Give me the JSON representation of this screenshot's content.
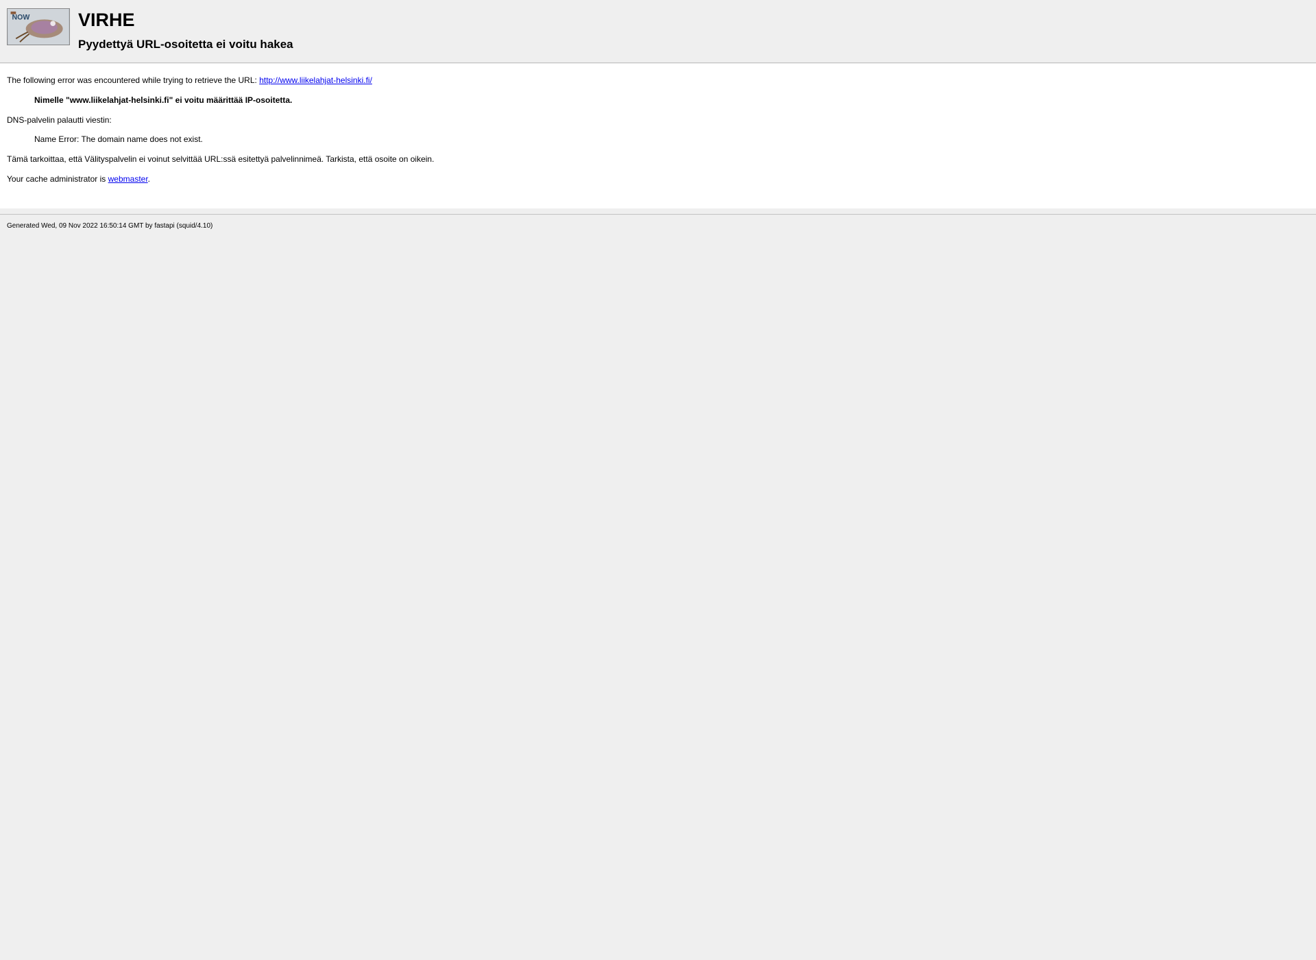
{
  "header": {
    "title": "VIRHE",
    "subtitle": "Pyydettyä URL-osoitetta ei voitu hakea"
  },
  "content": {
    "intro_text": "The following error was encountered while trying to retrieve the URL: ",
    "url": "http://www.liikelahjat-helsinki.fi/",
    "dns_error": "Nimelle \"www.liikelahjat-helsinki.fi\" ei voitu määrittää IP-osoitetta.",
    "dns_server_message_label": "DNS-palvelin palautti viestin:",
    "dns_server_message": "Name Error: The domain name does not exist.",
    "explanation": "Tämä tarkoittaa, että Välityspalvelin ei voinut selvittää URL:ssä esitettyä palvelinnimeä. Tarkista, että osoite on oikein.",
    "admin_text": "Your cache administrator is ",
    "admin_link": "webmaster",
    "admin_period": "."
  },
  "footer": {
    "generated": "Generated Wed, 09 Nov 2022 16:50:14 GMT by fastapi (squid/4.10)"
  }
}
